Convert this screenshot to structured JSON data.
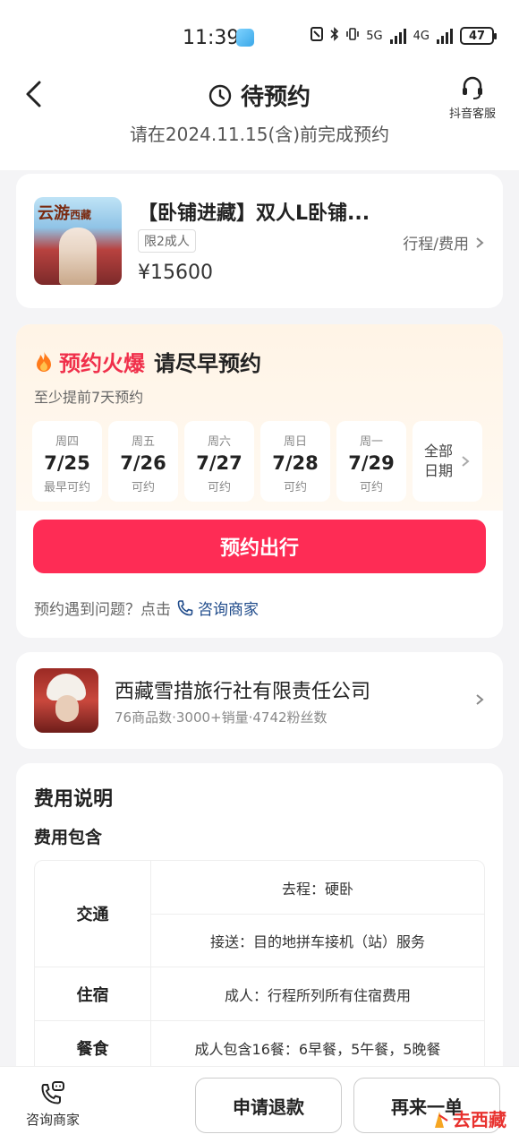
{
  "status_bar": {
    "time": "11:39",
    "battery": "47",
    "net_1": "5G",
    "net_2": "4G"
  },
  "header": {
    "title": "待预约",
    "service_label": "抖音客服",
    "deadline": "请在2024.11.15(含)前完成预约"
  },
  "product": {
    "thumb_text": "云游",
    "thumb_sub": "西藏",
    "title": "【卧铺进藏】双人L卧铺...",
    "tag": "限2成人",
    "link_label": "行程/费用",
    "price": "¥15600"
  },
  "booking": {
    "hot_label": "预约火爆",
    "hot_sub": "请尽早预约",
    "advance_note": "至少提前7天预约",
    "dates": [
      {
        "dow": "周四",
        "day": "7/25",
        "status": "最早可约"
      },
      {
        "dow": "周五",
        "day": "7/26",
        "status": "可约"
      },
      {
        "dow": "周六",
        "day": "7/27",
        "status": "可约"
      },
      {
        "dow": "周日",
        "day": "7/28",
        "status": "可约"
      },
      {
        "dow": "周一",
        "day": "7/29",
        "status": "可约"
      }
    ],
    "all_dates_label": "全部日期",
    "book_button": "预约出行",
    "help_text": "预约遇到问题？点击",
    "consult_link": "咨询商家"
  },
  "shop": {
    "name": "西藏雪措旅行社有限责任公司",
    "stats": "76商品数·3000+销量·4742粉丝数"
  },
  "fees": {
    "title": "费用说明",
    "subtitle": "费用包含",
    "rows": [
      {
        "category": "交通",
        "items": [
          "去程：硬卧",
          "接送：目的地拼车接机（站）服务"
        ]
      },
      {
        "category": "住宿",
        "items": [
          "成人：行程所列所有住宿费用"
        ]
      },
      {
        "category": "餐食",
        "items": [
          "成人包含16餐：6早餐，5午餐，5晚餐"
        ]
      }
    ]
  },
  "bottom_bar": {
    "consult_label": "咨询商家",
    "refund_button": "申请退款",
    "reorder_button": "再来一单"
  },
  "watermark": {
    "text": "去西藏"
  },
  "colors": {
    "accent": "#fe2c55",
    "hot": "#f0304b",
    "link": "#1e4a8a"
  }
}
